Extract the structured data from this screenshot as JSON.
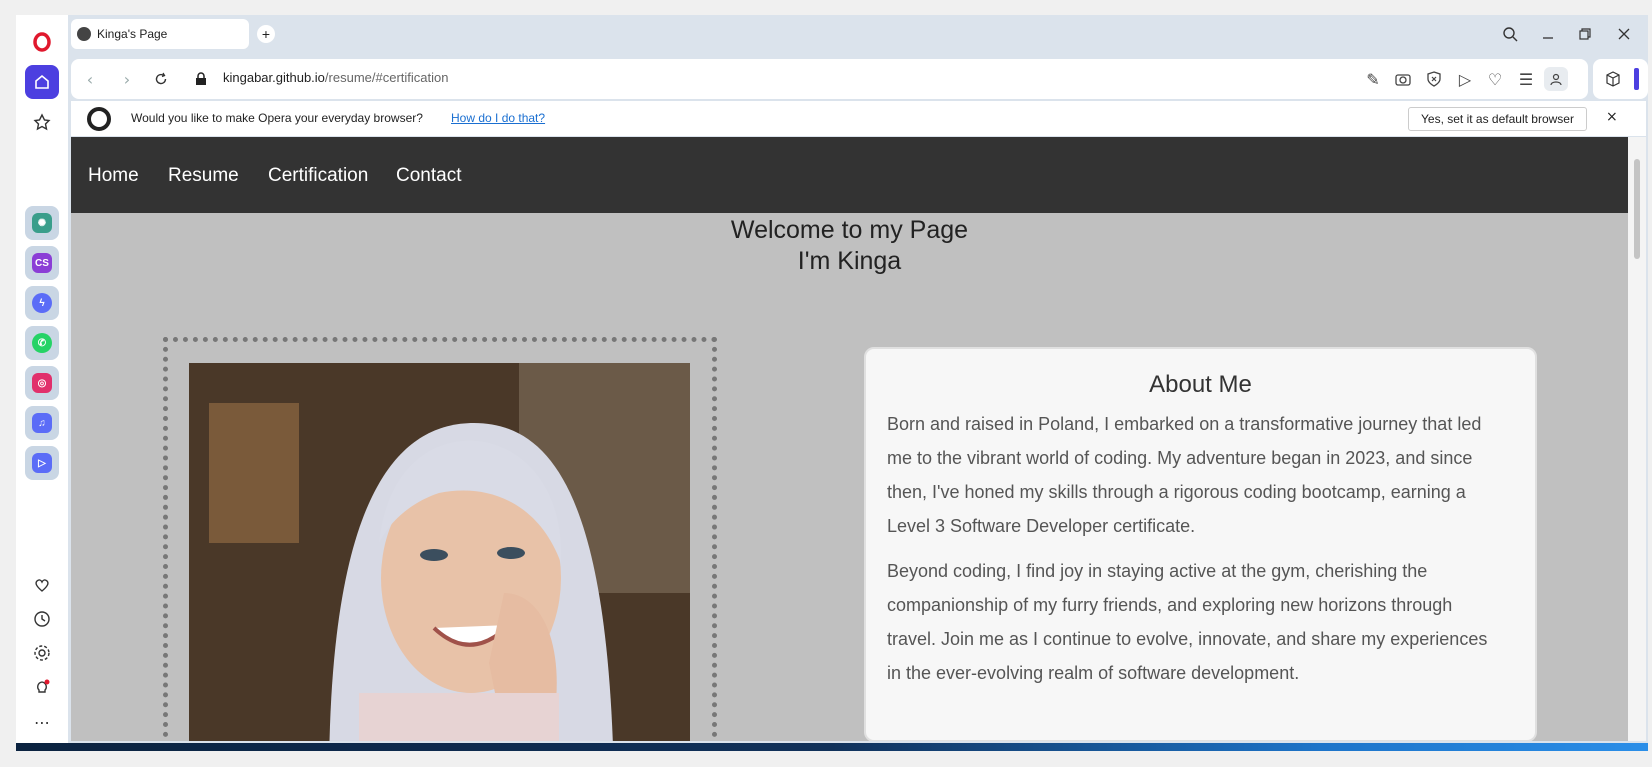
{
  "browser": {
    "tab_title": "Kinga's Page",
    "new_tab": "+",
    "url_domain": "kingabar.github.io",
    "url_path": "/resume/#certification"
  },
  "banner": {
    "message": "Would you like to make Opera your everyday browser?",
    "link": "How do I do that?",
    "button": "Yes, set it as default browser",
    "close": "×"
  },
  "sidebar": {
    "apps": [
      {
        "name": "chatgpt",
        "color": "#3a9e8b",
        "label": ""
      },
      {
        "name": "cs",
        "color": "#8b3ed6",
        "label": "CS"
      },
      {
        "name": "messenger",
        "color": "#5b6cf7",
        "label": ""
      },
      {
        "name": "whatsapp",
        "color": "#25d366",
        "label": ""
      },
      {
        "name": "instagram",
        "color": "#e1306c",
        "label": ""
      },
      {
        "name": "music",
        "color": "#5b6cf7",
        "label": ""
      },
      {
        "name": "player",
        "color": "#5b6cf7",
        "label": ""
      }
    ]
  },
  "page": {
    "nav": [
      "Home",
      "Resume",
      "Certification",
      "Contact"
    ],
    "welcome_line1": "Welcome to my Page",
    "welcome_line2": "I'm Kinga",
    "about_title": "About Me",
    "about_p1": "Born and raised in Poland, I embarked on a transformative journey that led me to the vibrant world of coding. My adventure began in 2023, and since then, I've honed my skills through a rigorous coding bootcamp, earning a Level 3 Software Developer certificate.",
    "about_p2": "Beyond coding, I find joy in staying active at the gym, cherishing the companionship of my furry friends, and exploring new horizons through travel. Join me as I continue to evolve, innovate, and share my experiences in the ever-evolving realm of software development."
  }
}
